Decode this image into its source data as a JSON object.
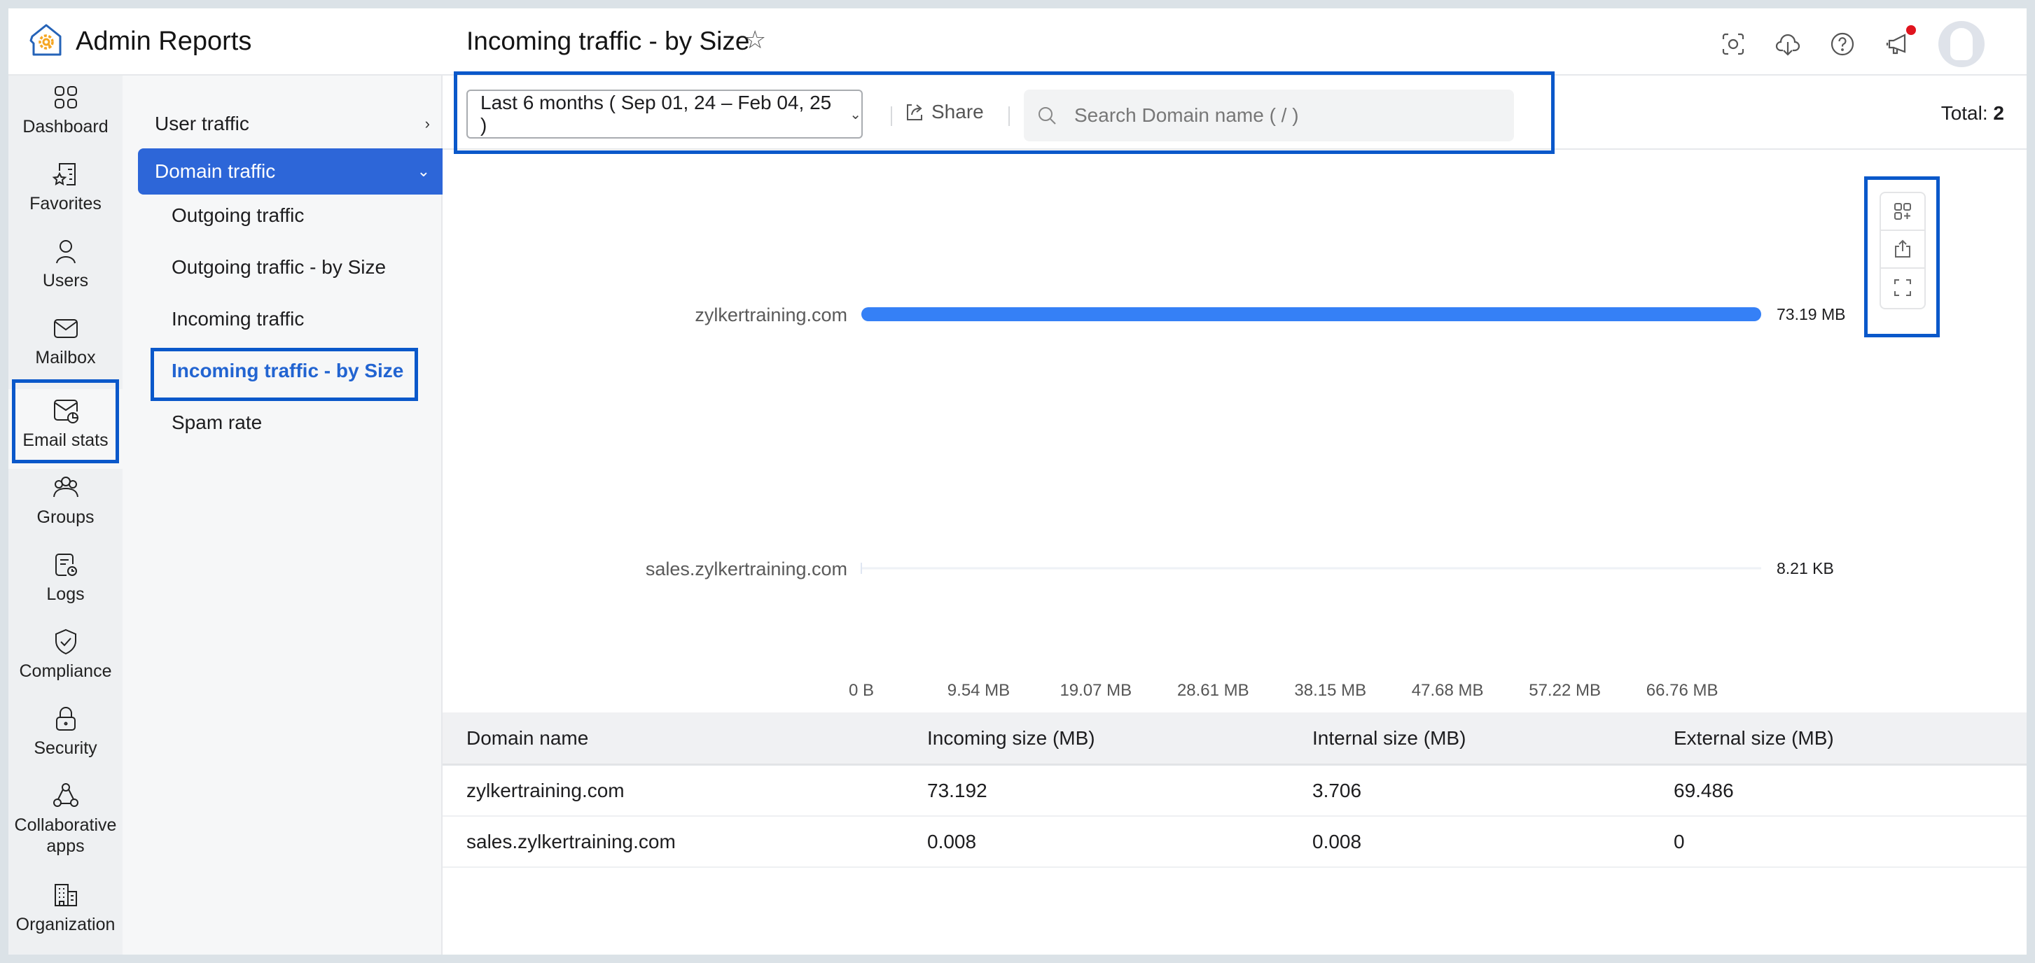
{
  "app": {
    "title": "Admin Reports"
  },
  "rail": {
    "items": [
      {
        "label": "Dashboard",
        "icon": "dashboard-icon"
      },
      {
        "label": "Favorites",
        "icon": "favorites-icon"
      },
      {
        "label": "Users",
        "icon": "user-icon"
      },
      {
        "label": "Mailbox",
        "icon": "mailbox-icon"
      },
      {
        "label": "Email stats",
        "icon": "email-stats-icon",
        "active": true
      },
      {
        "label": "Groups",
        "icon": "groups-icon"
      },
      {
        "label": "Logs",
        "icon": "logs-icon"
      },
      {
        "label": "Compliance",
        "icon": "compliance-shield-icon"
      },
      {
        "label": "Security",
        "icon": "lock-icon"
      },
      {
        "label": "Collaborative apps",
        "icon": "collaborative-apps-icon"
      },
      {
        "label": "Organization",
        "icon": "organization-building-icon"
      }
    ]
  },
  "submenu": {
    "user_traffic": "User traffic",
    "domain_traffic": "Domain traffic",
    "children": [
      "Outgoing traffic",
      "Outgoing traffic - by Size",
      "Incoming traffic",
      "Incoming traffic - by Size",
      "Spam rate"
    ],
    "active_child": "Incoming traffic - by Size"
  },
  "header": {
    "page_title": "Incoming traffic - by Size",
    "icons": [
      "screenshot-icon",
      "cloud-download-icon",
      "help-icon",
      "announcement-icon",
      "avatar"
    ]
  },
  "toolbar": {
    "date_range": "Last 6 months ( Sep 01, 24 – Feb 04, 25 )",
    "share_label": "Share",
    "search_placeholder": "Search Domain name ( / )",
    "total_label": "Total:",
    "total_value": "2"
  },
  "chart_tools": [
    "add-widget-icon",
    "export-icon",
    "fullscreen-icon"
  ],
  "chart_data": {
    "type": "bar",
    "orientation": "horizontal",
    "categories": [
      "zylkertraining.com",
      "sales.zylkertraining.com"
    ],
    "values_mb": [
      73.19,
      0.008
    ],
    "value_labels": [
      "73.19 MB",
      "8.21 KB"
    ],
    "x_ticks": [
      "0 B",
      "9.54 MB",
      "19.07 MB",
      "28.61 MB",
      "38.15 MB",
      "47.68 MB",
      "57.22 MB",
      "66.76 MB"
    ],
    "x_tick_values_mb": [
      0,
      9.54,
      19.07,
      28.61,
      38.15,
      47.68,
      57.22,
      66.76
    ],
    "xlim_mb": [
      0,
      73.19
    ],
    "bar_color": "#3580f6",
    "grid": false,
    "legend": "none",
    "title": "",
    "xlabel": "",
    "ylabel": ""
  },
  "table": {
    "columns": [
      "Domain name",
      "Incoming size (MB)",
      "Internal size (MB)",
      "External size (MB)"
    ],
    "rows": [
      [
        "zylkertraining.com",
        "73.192",
        "3.706",
        "69.486"
      ],
      [
        "sales.zylkertraining.com",
        "0.008",
        "0.008",
        "0"
      ]
    ]
  }
}
